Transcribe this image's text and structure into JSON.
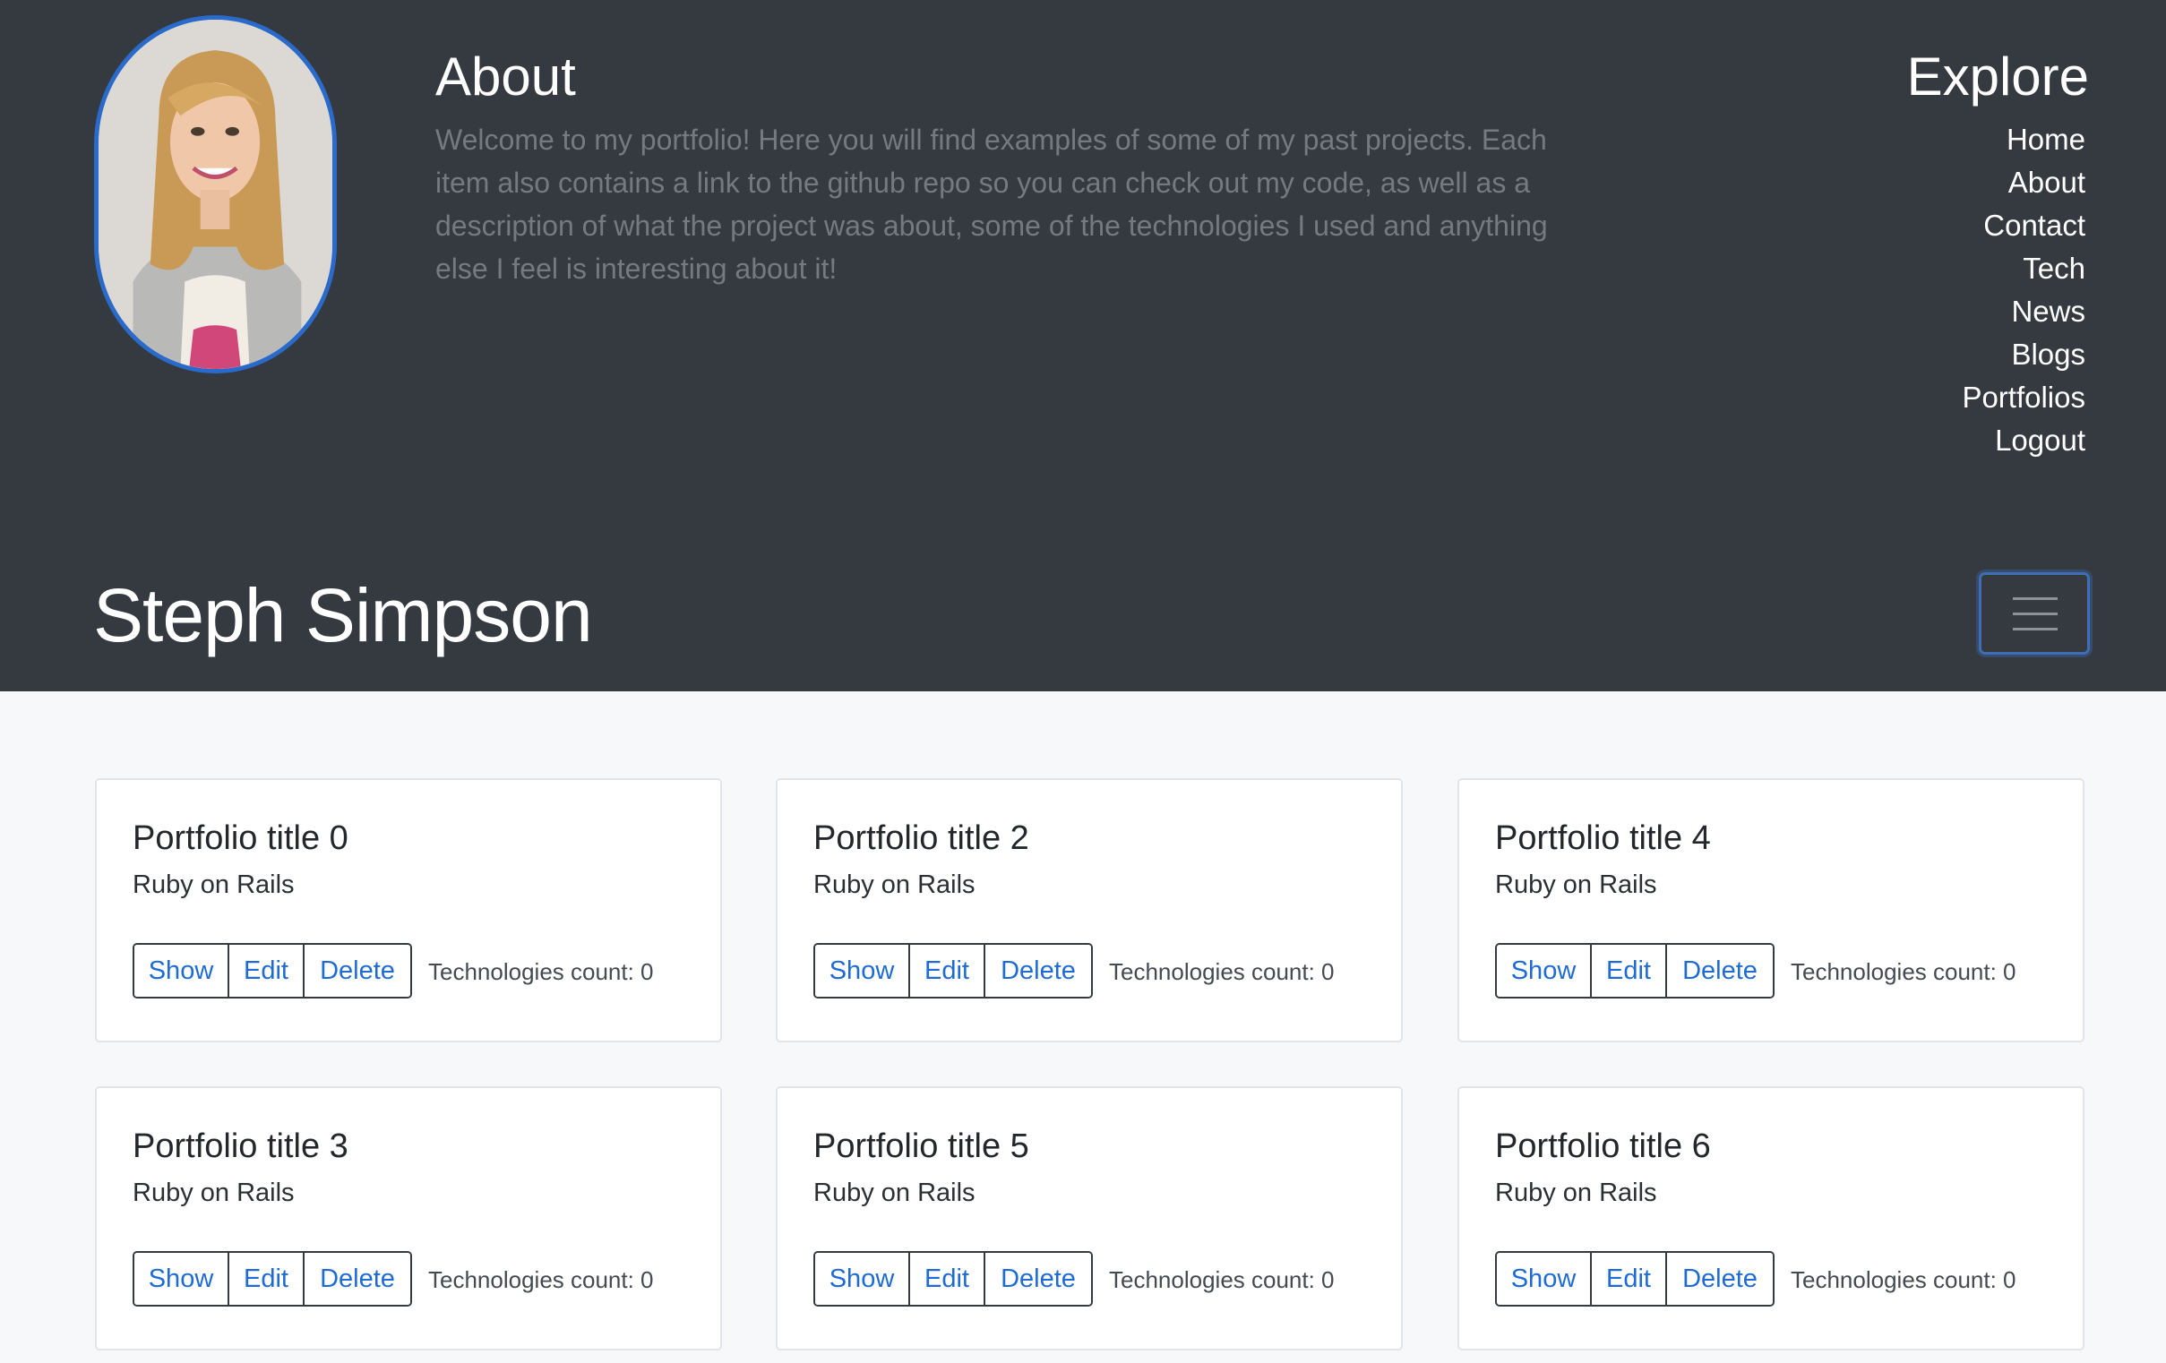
{
  "about": {
    "title": "About",
    "text": "Welcome to my portfolio! Here you will find examples of some of my past projects. Each item also contains a link to the github repo so you can check out my code, as well as a description of what the project was about, some of the technologies I used and anything else I feel is interesting about it!"
  },
  "explore": {
    "title": "Explore",
    "links": [
      "Home",
      "About",
      "Contact",
      "Tech",
      "News",
      "Blogs",
      "Portfolios",
      "Logout"
    ]
  },
  "brand": "Steph Simpson",
  "colors": {
    "header_bg": "#343a40",
    "accent": "#1f6bd6",
    "page_bg": "#f7f8fa"
  },
  "icons": {
    "toggler": "hamburger-menu-icon"
  },
  "cards": [
    {
      "title": "Portfolio title 0",
      "subtitle": "Ruby on Rails",
      "show": "Show",
      "edit": "Edit",
      "delete": "Delete",
      "count": "Technologies count: 0"
    },
    {
      "title": "Portfolio title 2",
      "subtitle": "Ruby on Rails",
      "show": "Show",
      "edit": "Edit",
      "delete": "Delete",
      "count": "Technologies count: 0"
    },
    {
      "title": "Portfolio title 4",
      "subtitle": "Ruby on Rails",
      "show": "Show",
      "edit": "Edit",
      "delete": "Delete",
      "count": "Technologies count: 0"
    },
    {
      "title": "Portfolio title 3",
      "subtitle": "Ruby on Rails",
      "show": "Show",
      "edit": "Edit",
      "delete": "Delete",
      "count": "Technologies count: 0"
    },
    {
      "title": "Portfolio title 5",
      "subtitle": "Ruby on Rails",
      "show": "Show",
      "edit": "Edit",
      "delete": "Delete",
      "count": "Technologies count: 0"
    },
    {
      "title": "Portfolio title 6",
      "subtitle": "Ruby on Rails",
      "show": "Show",
      "edit": "Edit",
      "delete": "Delete",
      "count": "Technologies count: 0"
    }
  ]
}
